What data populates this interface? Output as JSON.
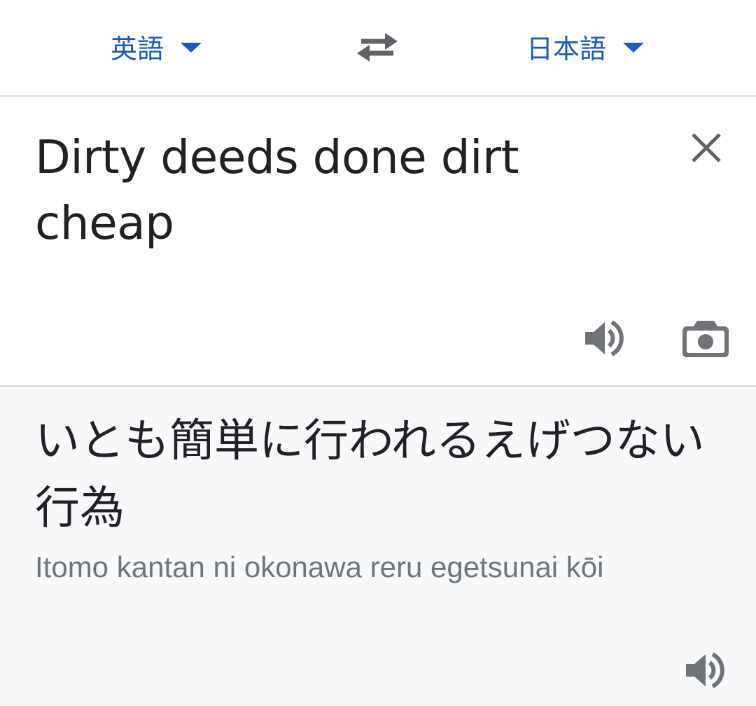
{
  "language_bar": {
    "source_language": "英語",
    "target_language": "日本語",
    "swap_icon": "swap-arrows-icon",
    "dropdown_icon": "caret-down-icon",
    "accent_color": "#1a5bc4"
  },
  "input": {
    "text": "Dirty deeds done dirt cheap",
    "clear_icon": "close-icon",
    "speaker_icon": "speaker-icon",
    "camera_icon": "camera-icon"
  },
  "output": {
    "translation": "いとも簡単に行われるえげつない行為",
    "romanization": "Itomo kantan ni okonawa reru egetsunai kōi",
    "speaker_icon": "speaker-icon"
  }
}
